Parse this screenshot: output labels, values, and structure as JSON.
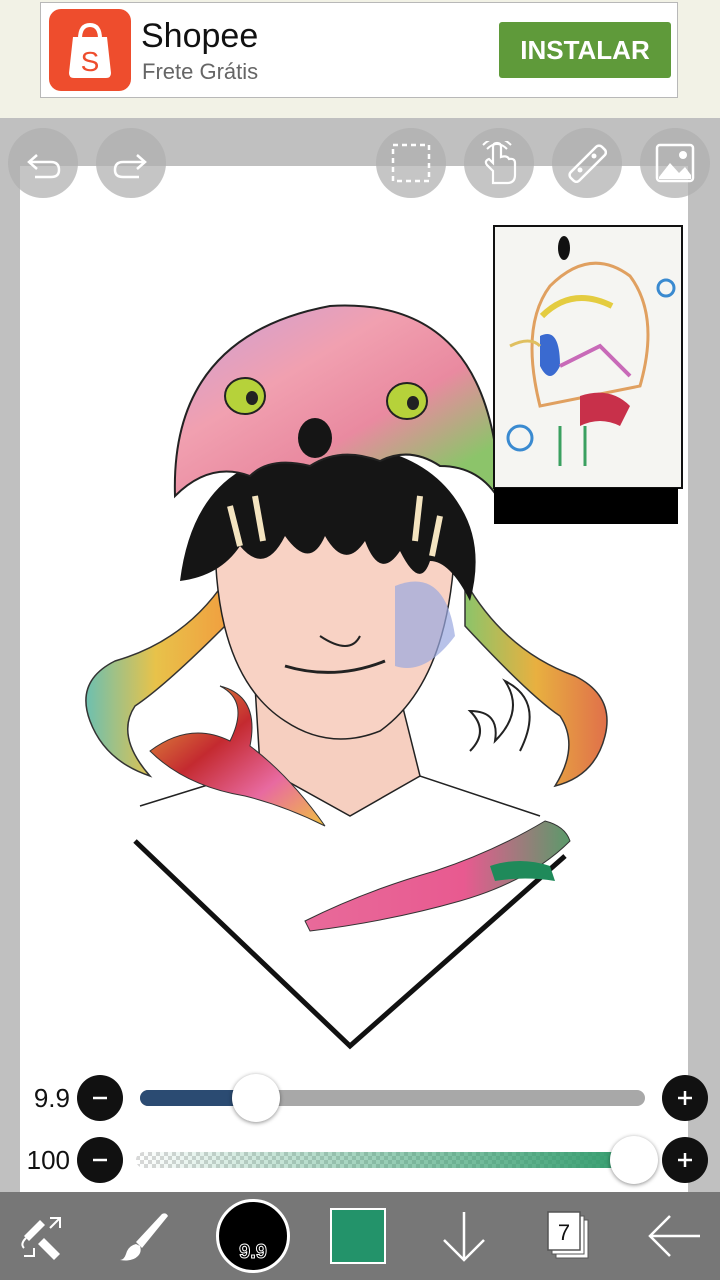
{
  "ad": {
    "app_name": "Shopee",
    "subtitle": "Frete Grátis",
    "install_label": "INSTALAR",
    "logo_letter": "S",
    "brand_color": "#ee4d2d",
    "button_color": "#5f9a3a"
  },
  "toolbar": {
    "icons": [
      "undo-icon",
      "redo-icon",
      "selection-icon",
      "hand-touch-icon",
      "ruler-icon",
      "image-icon"
    ]
  },
  "brush_size": {
    "label": "9.9",
    "fraction": 0.23,
    "fill_color": "#2b4b72"
  },
  "opacity": {
    "label": "100",
    "fraction": 1.0,
    "fill_color": "#2e9a6a"
  },
  "bottom": {
    "brush_preview_label": "9.9",
    "current_color": "#23936a",
    "layer_count": "7",
    "icons": [
      "transform-tools-icon",
      "brush-icon",
      "brush-preview",
      "color-swatch",
      "download-arrow-icon",
      "layers-icon",
      "back-arrow-icon"
    ]
  }
}
